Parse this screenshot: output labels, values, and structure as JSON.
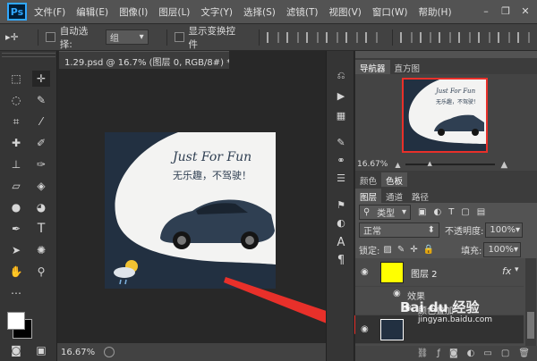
{
  "app": {
    "logo": "Ps"
  },
  "menu": [
    "文件(F)",
    "编辑(E)",
    "图像(I)",
    "图层(L)",
    "文字(Y)",
    "选择(S)",
    "滤镜(T)",
    "视图(V)",
    "窗口(W)",
    "帮助(H)"
  ],
  "window_controls": {
    "minimize": "–",
    "restore": "❐",
    "close": "✕"
  },
  "options": {
    "move_icon": "▸✛",
    "auto_select_label": "自动选择:",
    "auto_select_value": "组",
    "show_transform_label": "显示变换控件"
  },
  "document": {
    "tab_title": "1.29.psd @ 16.7% (图层 0, RGB/8#) *",
    "tab_close": "×",
    "zoom": "16.67%"
  },
  "artwork": {
    "headline": "Just For Fun",
    "slogan": "无乐趣，不驾驶！"
  },
  "navigator": {
    "tabs": [
      "导航器",
      "直方图"
    ],
    "zoom": "16.67%",
    "art_headline": "Just For Fun",
    "art_slogan": "无乐趣，不驾驶！"
  },
  "color_panel": {
    "tabs": [
      "颜色",
      "色板"
    ]
  },
  "layers": {
    "tabs": [
      "图层",
      "通道",
      "路径"
    ],
    "filter_label": "类型",
    "blend_mode": "正常",
    "opacity_label": "不透明度:",
    "opacity_value": "100%",
    "lock_label": "锁定:",
    "fill_label": "填充:",
    "fill_value": "100%",
    "layer2_name": "图层 2",
    "fx": "fx",
    "effects_label": "效果",
    "color_overlay_label": "颜色叠加"
  },
  "watermark": {
    "text": "Bai du 经验",
    "url": "jingyan.baidu.com"
  },
  "colors": {
    "menu_bg": "#535353",
    "panel_bg": "#535353",
    "toolbar_bg": "#353535",
    "canvas_bg": "#282828",
    "doc_bg": "#223041",
    "accent_red": "#e8302a",
    "layer_thumb_yellow": "#ffff00"
  }
}
